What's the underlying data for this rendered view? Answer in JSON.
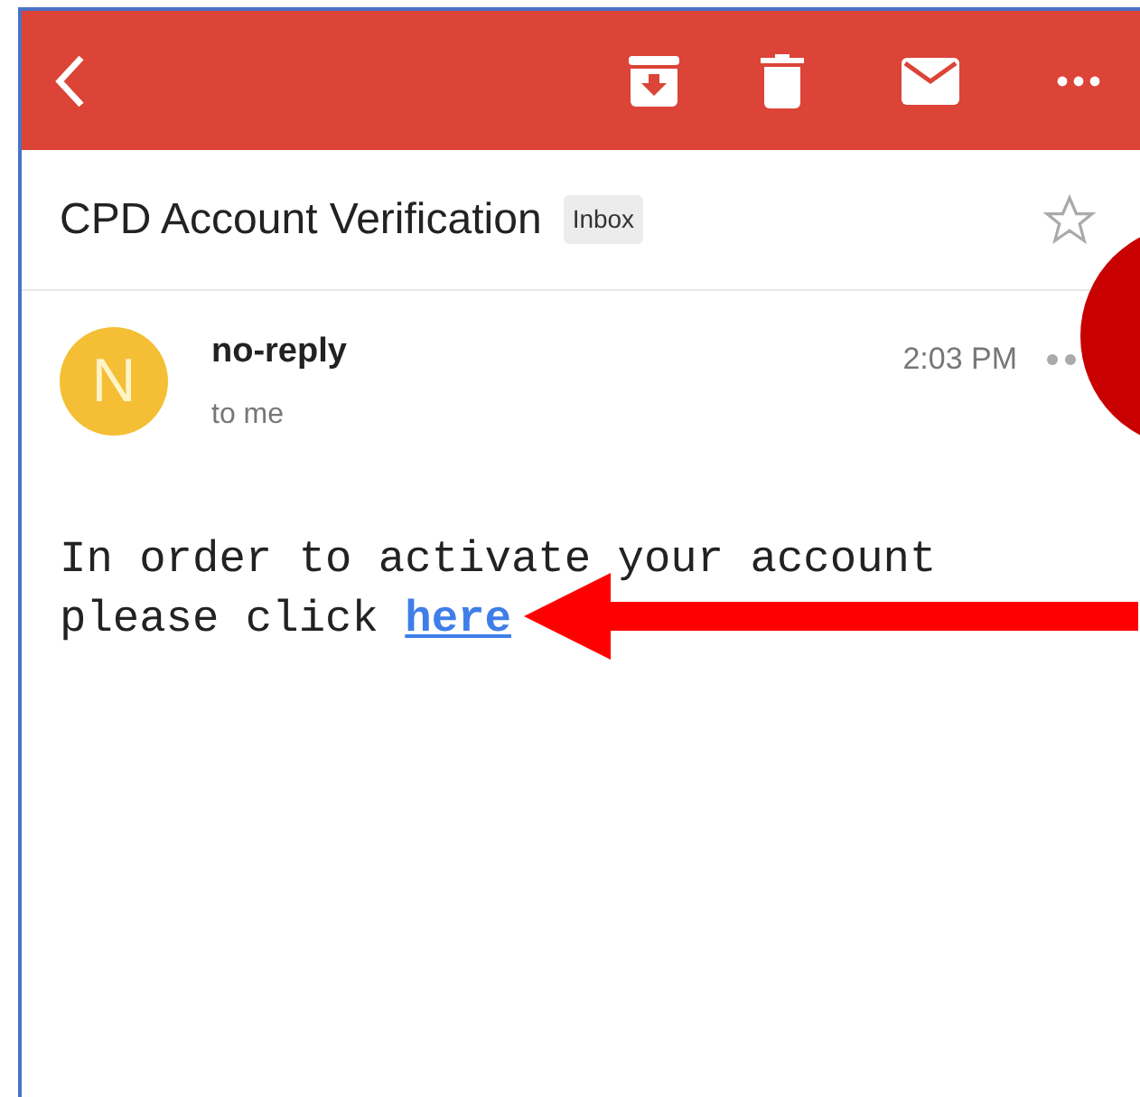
{
  "toolbar": {
    "actions": [
      {
        "kind": "back"
      },
      {
        "kind": "archive"
      },
      {
        "kind": "delete"
      },
      {
        "kind": "mail"
      },
      {
        "kind": "more"
      }
    ]
  },
  "subject": {
    "title": "CPD Account Verification",
    "label": "Inbox",
    "starred": false
  },
  "message": {
    "sender": "no-reply",
    "initial": "N",
    "recipient": "to me",
    "time": "2:03 PM",
    "body_lines": [
      {
        "text": "In order to activate your account"
      },
      {
        "text": "please click",
        "link": "here"
      }
    ]
  }
}
